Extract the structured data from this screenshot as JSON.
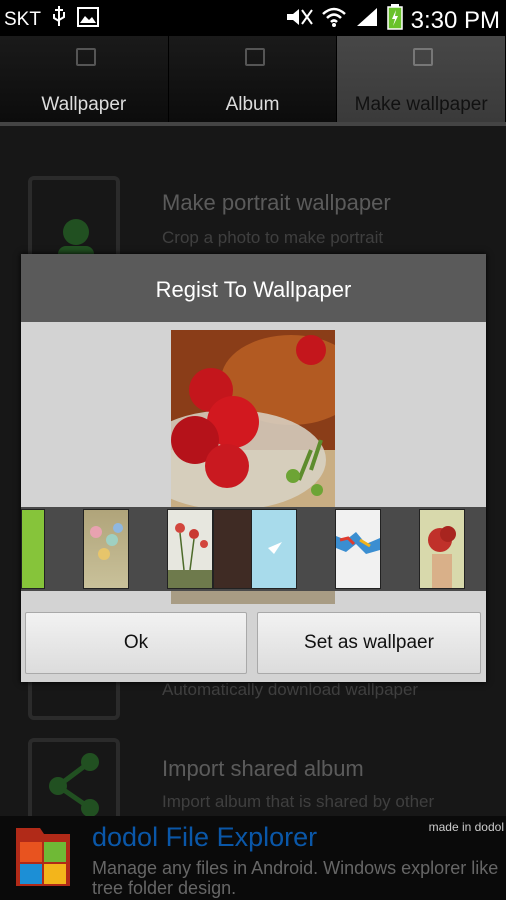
{
  "status_bar": {
    "carrier": "SKT",
    "time": "3:30 PM",
    "icons": [
      "usb-icon",
      "image-icon",
      "mute-icon",
      "wifi-icon",
      "signal-icon",
      "battery-icon"
    ]
  },
  "tabs": [
    {
      "label": "Wallpaper",
      "icon": "image-icon",
      "active": false
    },
    {
      "label": "Album",
      "icon": "share-icon",
      "active": false
    },
    {
      "label": "Make wallpaper",
      "icon": "crop-icon",
      "active": true
    }
  ],
  "background_list": [
    {
      "title": "Make portrait wallpaper",
      "subtitle": "Crop a photo to make portrait",
      "icon": "person-icon"
    },
    {
      "title": "",
      "subtitle": "Automatically download wallpaper",
      "icon": "search-icon"
    },
    {
      "title": "Import shared album",
      "subtitle": "Import album that is shared by other",
      "icon": "share-icon"
    }
  ],
  "dialog": {
    "title": "Regist To Wallpaper",
    "preview_image": "strawberries-in-glass-bowl",
    "thumbnails": [
      "green-leaf",
      "balloons-wall",
      "red-flowers",
      "strawberry",
      "light-blue-screen",
      "paper-cranes",
      "red-roses"
    ],
    "ok_label": "Ok",
    "set_label": "Set as wallpaer"
  },
  "banner": {
    "app_name": "dodol File Explorer",
    "description": "Manage any files in Android. Windows explorer like tree folder design.",
    "made_in": "made in dodol"
  },
  "colors": {
    "accent": "#0a57a8",
    "dialog_title_bg": "#5a5a5a",
    "dialog_bg": "#d3d3d3"
  }
}
